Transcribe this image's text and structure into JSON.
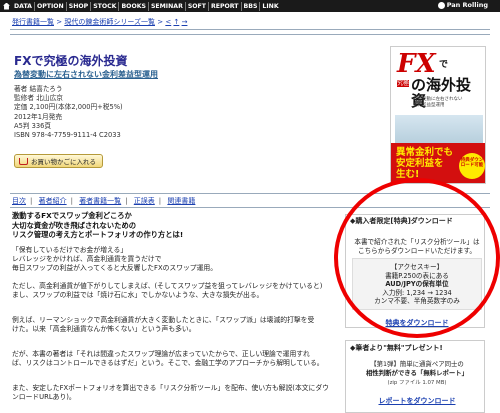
{
  "topnav": {
    "items": [
      "DATA",
      "OPTION",
      "SHOP",
      "STOCK",
      "BOOKS",
      "SEMINAR",
      "SOFT",
      "REPORT",
      "BBS",
      "LINK"
    ],
    "logo": "Pan Rolling"
  },
  "breadcrumb": {
    "item1": "発行書籍一覧",
    "sep": ">",
    "item2": "現代の錬金術師シリーズ一覧",
    "nav": [
      "<",
      "↑",
      "→"
    ]
  },
  "book": {
    "title": "FXで究極の海外投資",
    "subtitle": "為替変動に左右されない金利差益型運用",
    "meta": [
      "著者 結喜たろう",
      "監修者 北山広京",
      "定価 2,100円(本体2,000円+税5%)",
      "2012年1月発売",
      "A5判 336頁",
      "ISBN 978-4-7759-9111-4  C2033"
    ],
    "order_button": "お買い物かごに入れる"
  },
  "cover": {
    "fx": "FX",
    "de": "で",
    "kyukyoku": "究極",
    "big": "の海外投資",
    "small": "為替変動に左右されない金利差益型運用",
    "yellow1": "異常金利でも",
    "yellow2": "安定利益を",
    "yellow3": "生む!",
    "badge": "特典ダウンロード可能"
  },
  "tabs": [
    "目次",
    "著者紹介",
    "著者書籍一覧",
    "正誤表",
    "関連書籍"
  ],
  "tab_sep": "|",
  "main": {
    "headline": [
      "激動するFXでスワップ金利どころか",
      "大切な資金が吹き飛ばされないための",
      "リスク管理の考え方とポートフォリオの作り方とは!"
    ],
    "paragraphs": [
      "「保有しているだけでお金が増える」",
      "レバレッジをかければ、高金利通貨を買うだけで",
      "毎日スワップの利益が入ってくると大反響したFXのスワップ運用。",
      "ただし、高金利通貨が値下がりしてしまえば、(そしてスワップ益を狙ってレバレッジをかけていると)",
      "まし、スワップの利益では「焼け石に水」でしかないような、大きな損失が出る。",
      "例えば、リーマンショックで高金利通貨が大きく変動したときに、「スワップ派」は壊滅的打撃を受",
      "けた。以来「高金利通貨なんか怖くない」という声も多い。",
      "だが、本書の著者は「それは間違ったスワップ理論が広まっていたからで、正しい理論で運用すれ",
      "ば、リスクはコントロールできるはずだ」という。そこで、金融工学のアプローチから解明している。",
      "また、安定したFXポートフォリオを算出できる「リスク分析ツール」を配布、使い方も解説(本文にダウ",
      "ンロードURLあり)。"
    ]
  },
  "sidebar": {
    "box1_head": "◆購入者限定[特典]ダウンロード",
    "box1_text": "本書で紹介された「リスク分析ツール」はこちらからダウンロードいただけます。",
    "access_title": "【アクセスキー】",
    "access_line1": "書籍P.250の表にある",
    "access_line2": "AUD/JPYの保有単位",
    "access_line3": "入力例: 1,234 → 1234",
    "access_line4": "カンマ不要、半角英数字のみ",
    "download_link": "特典をダウンロード",
    "box2_head": "◆筆者より\"無料\"プレゼント!",
    "box2_text1": "【第1弾】簡単に通貨ペア同士の",
    "box2_text2": "相性判断ができる「無料レポート」",
    "box2_note": "(zip ファイル 1.07 MB)",
    "report_link": "レポートをダウンロード"
  },
  "colors": {
    "topbar": "#1a1a1a",
    "link": "#1a3fb0",
    "highlight_circle": "#ee0000",
    "cover_red": "#d30f0f",
    "cover_yellow": "#ffea00"
  }
}
